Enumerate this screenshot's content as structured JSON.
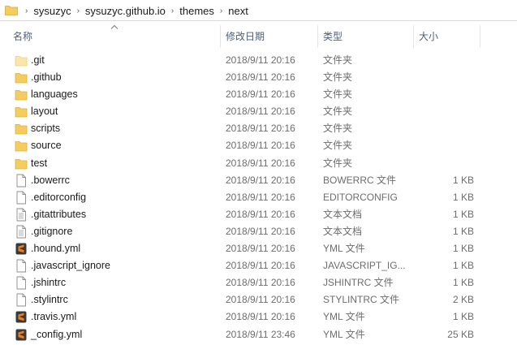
{
  "breadcrumb": {
    "items": [
      "sysuzyc",
      "sysuzyc.github.io",
      "themes",
      "next"
    ],
    "separator": "›"
  },
  "columns": {
    "name": "名称",
    "date": "修改日期",
    "type": "类型",
    "size": "大小"
  },
  "files": [
    {
      "name": ".git",
      "date": "2018/9/11 20:16",
      "type": "文件夹",
      "size": "",
      "icon": "folder-light-icon"
    },
    {
      "name": ".github",
      "date": "2018/9/11 20:16",
      "type": "文件夹",
      "size": "",
      "icon": "folder-icon"
    },
    {
      "name": "languages",
      "date": "2018/9/11 20:16",
      "type": "文件夹",
      "size": "",
      "icon": "folder-icon"
    },
    {
      "name": "layout",
      "date": "2018/9/11 20:16",
      "type": "文件夹",
      "size": "",
      "icon": "folder-icon"
    },
    {
      "name": "scripts",
      "date": "2018/9/11 20:16",
      "type": "文件夹",
      "size": "",
      "icon": "folder-icon"
    },
    {
      "name": "source",
      "date": "2018/9/11 20:16",
      "type": "文件夹",
      "size": "",
      "icon": "folder-icon"
    },
    {
      "name": "test",
      "date": "2018/9/11 20:16",
      "type": "文件夹",
      "size": "",
      "icon": "folder-icon"
    },
    {
      "name": ".bowerrc",
      "date": "2018/9/11 20:16",
      "type": "BOWERRC 文件",
      "size": "1 KB",
      "icon": "file-icon"
    },
    {
      "name": ".editorconfig",
      "date": "2018/9/11 20:16",
      "type": "EDITORCONFIG",
      "size": "1 KB",
      "icon": "file-icon"
    },
    {
      "name": ".gitattributes",
      "date": "2018/9/11 20:16",
      "type": "文本文档",
      "size": "1 KB",
      "icon": "text-file-icon"
    },
    {
      "name": ".gitignore",
      "date": "2018/9/11 20:16",
      "type": "文本文档",
      "size": "1 KB",
      "icon": "text-file-icon"
    },
    {
      "name": ".hound.yml",
      "date": "2018/9/11 20:16",
      "type": "YML 文件",
      "size": "1 KB",
      "icon": "sublime-file-icon"
    },
    {
      "name": ".javascript_ignore",
      "date": "2018/9/11 20:16",
      "type": "JAVASCRIPT_IG...",
      "size": "1 KB",
      "icon": "file-icon"
    },
    {
      "name": ".jshintrc",
      "date": "2018/9/11 20:16",
      "type": "JSHINTRC 文件",
      "size": "1 KB",
      "icon": "file-icon"
    },
    {
      "name": ".stylintrc",
      "date": "2018/9/11 20:16",
      "type": "STYLINTRC 文件",
      "size": "2 KB",
      "icon": "file-icon"
    },
    {
      "name": ".travis.yml",
      "date": "2018/9/11 20:16",
      "type": "YML 文件",
      "size": "1 KB",
      "icon": "sublime-file-icon"
    },
    {
      "name": "_config.yml",
      "date": "2018/9/11 23:46",
      "type": "YML 文件",
      "size": "25 KB",
      "icon": "sublime-file-icon"
    }
  ],
  "colors": {
    "folder": "#f5cd5e",
    "folder_light": "#fbe6a8",
    "sublime": "#f37d1b",
    "header_text": "#4c607a"
  }
}
